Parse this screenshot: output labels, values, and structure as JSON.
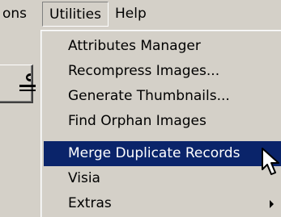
{
  "menubar": {
    "items": [
      "ons",
      "Utilities",
      "Help"
    ]
  },
  "utilities_menu": {
    "items": [
      {
        "label": "Attributes Manager",
        "selected": false,
        "has_submenu": false
      },
      {
        "label": "Recompress Images...",
        "selected": false,
        "has_submenu": false
      },
      {
        "label": "Generate Thumbnails...",
        "selected": false,
        "has_submenu": false
      },
      {
        "label": "Find Orphan Images",
        "selected": false,
        "has_submenu": false
      },
      {
        "label": "Merge Duplicate Records",
        "selected": true,
        "has_submenu": false
      },
      {
        "label": "Visia",
        "selected": false,
        "has_submenu": false
      },
      {
        "label": "Extras",
        "selected": false,
        "has_submenu": true
      }
    ]
  },
  "colors": {
    "menu_background": "#d4d0c8",
    "highlight": "#0a246a",
    "highlight_text": "#ffffff"
  }
}
